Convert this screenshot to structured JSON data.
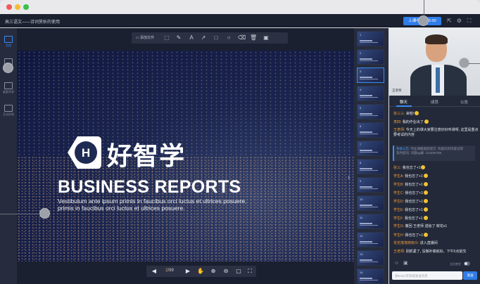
{
  "window": {
    "title": "高三语文——诗词赏析的使用"
  },
  "header": {
    "timer_label": "上课中 00:35:00",
    "icons": [
      "share-icon",
      "gear-icon",
      "fullscreen-icon"
    ]
  },
  "sidebar": {
    "items": [
      {
        "label": "文档",
        "icon": "document-icon",
        "active": true
      },
      {
        "label": "白板",
        "icon": "whiteboard-icon",
        "active": false
      },
      {
        "label": "桌面共享",
        "icon": "screen-share-icon",
        "active": false
      },
      {
        "label": "互动问答",
        "icon": "qa-icon",
        "active": false
      }
    ]
  },
  "toolbar": {
    "add_file_label": "添加文件",
    "tools": [
      "select-icon",
      "pen-icon",
      "text-icon",
      "arrow-icon",
      "rectangle-icon",
      "circle-icon",
      "eraser-icon",
      "trash-icon",
      "save-icon"
    ]
  },
  "slide": {
    "brand_text": "好智学",
    "logo_letter": "H",
    "headline": "BUSINESS REPORTS",
    "body_line1": "Vestibulum ante ipsum primis in faucibus orci luctus et ultrices posuere.",
    "body_line2": "primis in faucibus orci luctus et ultrices posuere."
  },
  "pager": {
    "current": "2",
    "total": "/99",
    "icons": [
      "prev-icon",
      "next-icon",
      "hand-icon",
      "zoom-in-icon",
      "zoom-out-icon",
      "fit-icon",
      "expand-icon"
    ]
  },
  "thumbnails": {
    "numbers": [
      "1",
      "2",
      "3",
      "4",
      "5",
      "6",
      "7",
      "8",
      "9",
      "10",
      "11",
      "12",
      "13",
      "14"
    ],
    "active_index": 2
  },
  "video": {
    "name": "王老师"
  },
  "chat": {
    "tabs": [
      {
        "label": "聊天",
        "active": true
      },
      {
        "label": "成员",
        "active": false
      },
      {
        "label": "公告",
        "active": false
      }
    ],
    "messages": [
      {
        "who": "张三三:",
        "text": "来啦!",
        "emoji": true
      },
      {
        "who": "李四:",
        "text": "我的作业出了",
        "emoji": true
      },
      {
        "who": "王老师:",
        "text": "今天上的课大家要注意好好听课呀, 这里是重点",
        "text2": "要考试的内容"
      },
      {
        "who": "张三:",
        "text": "我也忘了+1",
        "emoji": true
      },
      {
        "who": "学生A:",
        "text": "我也忘了+1",
        "emoji": true
      },
      {
        "who": "学生B:",
        "text": "我也忘了+1",
        "emoji": true
      },
      {
        "who": "学生C:",
        "text": "我也忘了+1",
        "emoji": true
      },
      {
        "who": "学生D:",
        "text": "我也忘了+1",
        "emoji": true
      },
      {
        "who": "学生E:",
        "text": "我也忘了+1",
        "emoji": true
      },
      {
        "who": "学生F:",
        "text": "我也忘了+1",
        "emoji": true
      },
      {
        "who": "学生G:",
        "text": "撤回 王老师 送给了 鲜花x1"
      },
      {
        "who": "学生H:",
        "text": "我也忘了+1",
        "emoji": true
      },
      {
        "who": "花花落落晓晓众:",
        "text": "进入直播间"
      },
      {
        "who": "王老师:",
        "text": "别抓紧了, 没做补做就好。下午5点前交"
      }
    ],
    "notice": {
      "line1_prefix": "系统公告:",
      "line1": "作业请截图后提交, 有疑问的内容记得",
      "line2": "及时提问, 问题qq群: 123456789"
    },
    "mute_label": "全员禁言",
    "input_placeholder": "按Enter可快速发送消息",
    "send_label": "发送"
  }
}
